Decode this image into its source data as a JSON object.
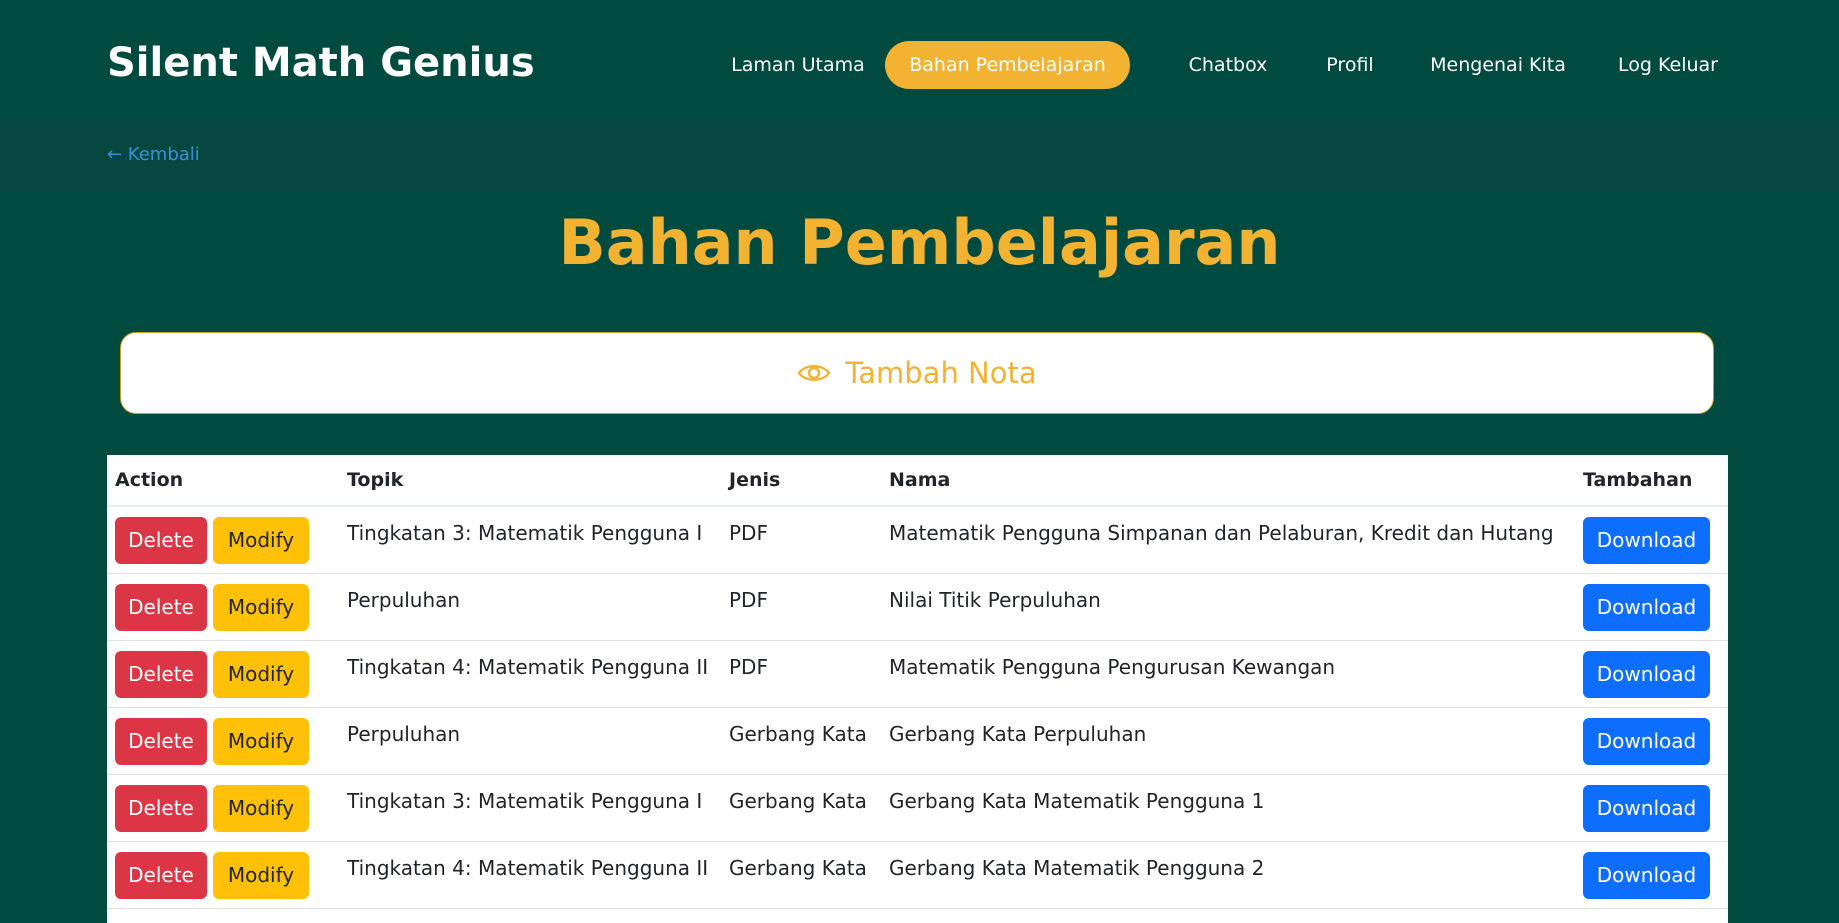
{
  "navbar": {
    "brand": "Silent Math Genius",
    "items": [
      {
        "label": "Laman Utama",
        "active": false
      },
      {
        "label": "Bahan Pembelajaran",
        "active": true
      },
      {
        "label": "Chatbox",
        "active": false
      },
      {
        "label": "Profil",
        "active": false
      },
      {
        "label": "Mengenai Kita",
        "active": false
      },
      {
        "label": "Log Keluar",
        "active": false
      }
    ]
  },
  "back_link": "← Kembali",
  "page_title": "Bahan Pembelajaran",
  "add_note": {
    "label": "Tambah Nota",
    "icon": "eye-icon"
  },
  "table": {
    "headers": [
      "Action",
      "Topik",
      "Jenis",
      "Nama",
      "Tambahan"
    ],
    "delete_label": "Delete",
    "modify_label": "Modify",
    "download_label": "Download",
    "rows": [
      {
        "topik": "Tingkatan 3: Matematik Pengguna I",
        "jenis": "PDF",
        "nama": "Matematik Pengguna Simpanan dan Pelaburan, Kredit dan Hutang"
      },
      {
        "topik": "Perpuluhan",
        "jenis": "PDF",
        "nama": "Nilai Titik Perpuluhan"
      },
      {
        "topik": "Tingkatan 4: Matematik Pengguna II",
        "jenis": "PDF",
        "nama": "Matematik Pengguna Pengurusan Kewangan"
      },
      {
        "topik": "Perpuluhan",
        "jenis": "Gerbang Kata",
        "nama": "Gerbang Kata Perpuluhan"
      },
      {
        "topik": "Tingkatan 3: Matematik Pengguna I",
        "jenis": "Gerbang Kata",
        "nama": "Gerbang Kata Matematik Pengguna 1"
      },
      {
        "topik": "Tingkatan 4: Matematik Pengguna II",
        "jenis": "Gerbang Kata",
        "nama": "Gerbang Kata Matematik Pengguna 2"
      }
    ]
  },
  "colors": {
    "background": "#014a40",
    "accent": "#f2b333",
    "delete": "#dc3545",
    "modify": "#ffc107",
    "download": "#0d6efd",
    "link": "#3b8fd6"
  }
}
